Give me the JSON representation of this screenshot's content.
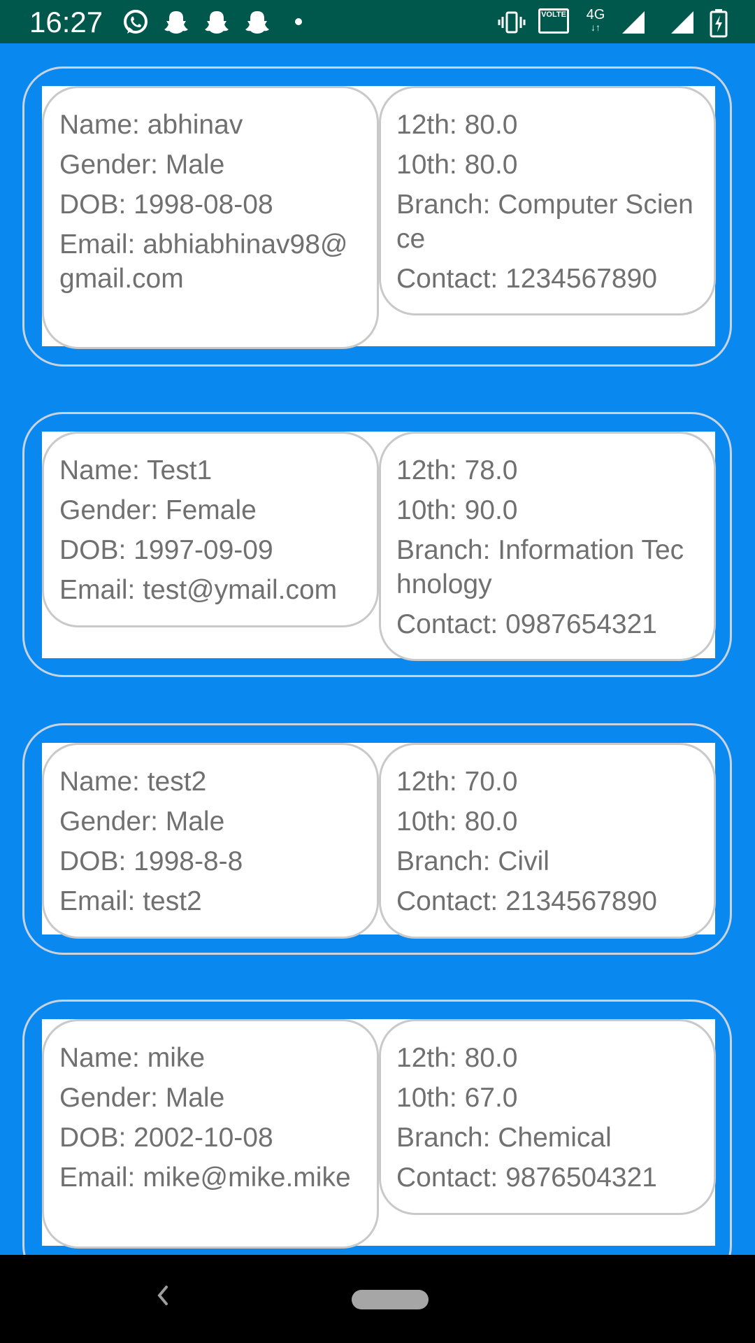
{
  "status_bar": {
    "time": "16:27",
    "icons": [
      "whatsapp-icon",
      "snapchat-icon",
      "snapchat-icon",
      "snapchat-icon",
      "dot-icon",
      "vibrate-icon",
      "volte-icon",
      "4g-icon",
      "signal-icon",
      "signal-icon",
      "battery-charging-icon"
    ],
    "volte_label": "VOLTE",
    "network_label": "4G"
  },
  "records": [
    {
      "name": "Name: abhinav",
      "gender": "Gender: Male",
      "dob": "DOB: 1998-08-08",
      "email": "Email: abhiabhinav98@gmail.com",
      "twelfth": "12th: 80.0",
      "tenth": "10th: 80.0",
      "branch": "Branch: Computer Science",
      "contact": "Contact: 1234567890"
    },
    {
      "name": "Name: Test1",
      "gender": "Gender: Female",
      "dob": "DOB: 1997-09-09",
      "email": "Email: test@ymail.com",
      "twelfth": "12th: 78.0",
      "tenth": "10th: 90.0",
      "branch": "Branch: Information Technology",
      "contact": "Contact: 0987654321"
    },
    {
      "name": "Name: test2",
      "gender": "Gender: Male",
      "dob": "DOB: 1998-8-8",
      "email": "Email: test2",
      "twelfth": "12th: 70.0",
      "tenth": "10th: 80.0",
      "branch": "Branch: Civil",
      "contact": "Contact: 2134567890"
    },
    {
      "name": "Name: mike",
      "gender": "Gender: Male",
      "dob": "DOB: 2002-10-08",
      "email": "Email: mike@mike.mike",
      "twelfth": "12th: 80.0",
      "tenth": "10th: 67.0",
      "branch": "Branch: Chemical",
      "contact": "Contact: 9876504321"
    }
  ],
  "nav_bar": {
    "icons": [
      "back-icon",
      "home-pill-icon"
    ]
  }
}
